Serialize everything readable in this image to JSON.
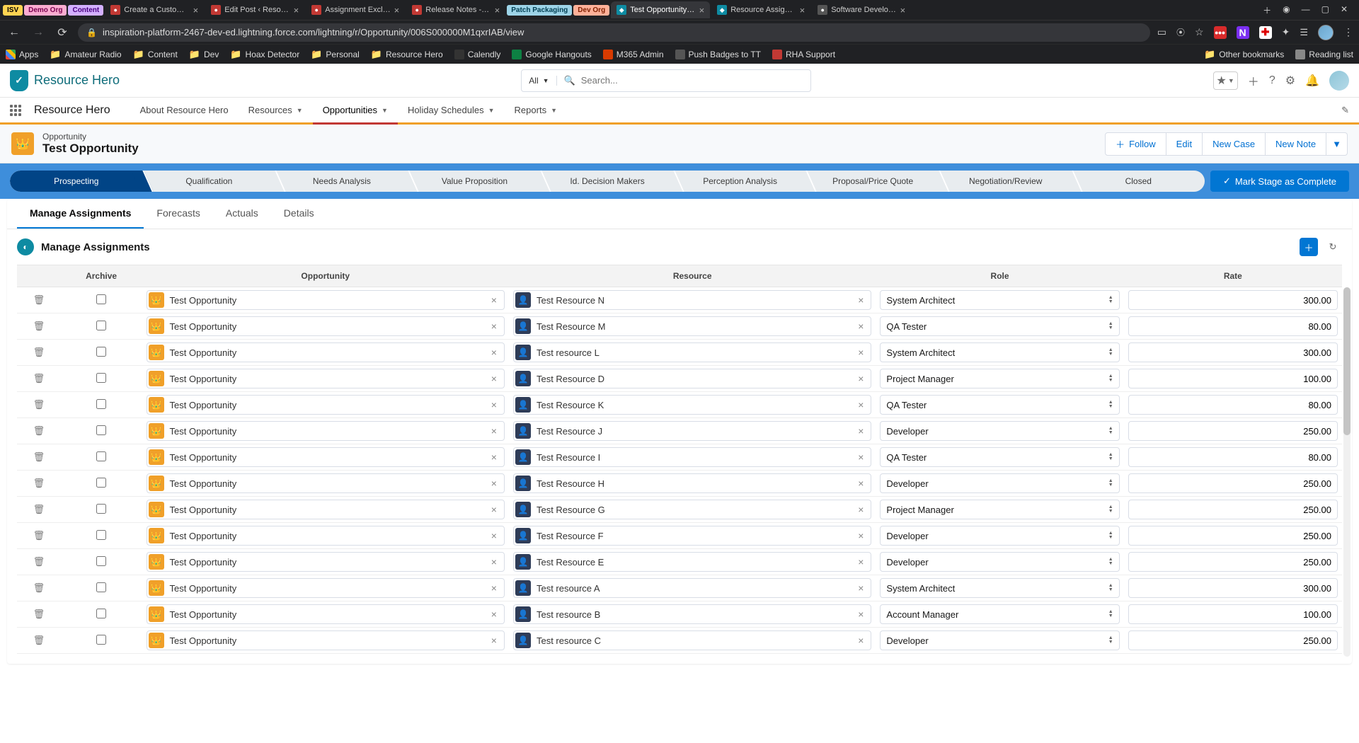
{
  "browser": {
    "tabs": [
      {
        "label": "ISV",
        "mini": "mini-isv"
      },
      {
        "label": "Demo Org",
        "mini": "mini-demo"
      },
      {
        "label": "Content",
        "mini": "mini-content"
      },
      {
        "label": "Create a Custom Ma",
        "fav_bg": "#c23934",
        "fav": "●"
      },
      {
        "label": "Edit Post ‹ Resource",
        "fav_bg": "#c23934",
        "fav": "●"
      },
      {
        "label": "Assignment Exclusio",
        "fav_bg": "#c23934",
        "fav": "●"
      },
      {
        "label": "Release Notes - Reso",
        "fav_bg": "#c23934",
        "fav": "●"
      },
      {
        "label": "Patch Packaging",
        "mini": "mini-patch"
      },
      {
        "label": "Dev Org",
        "mini": "mini-dev"
      },
      {
        "label": "Test Opportunity | Sa",
        "fav_bg": "#0e8ba2",
        "fav": "◆",
        "active": true
      },
      {
        "label": "Resource Assignmen",
        "fav_bg": "#0e8ba2",
        "fav": "◆"
      },
      {
        "label": "Software Developme",
        "fav_bg": "#555",
        "fav": "●"
      }
    ],
    "url": "inspiration-platform-2467-dev-ed.lightning.force.com/lightning/r/Opportunity/006S000000M1qxrIAB/view",
    "bookmarks_left": [
      {
        "label": "Apps",
        "icon_bg": "grid"
      },
      {
        "label": "Amateur Radio",
        "folder": true
      },
      {
        "label": "Content",
        "folder": true
      },
      {
        "label": "Dev",
        "folder": true
      },
      {
        "label": "Hoax Detector",
        "folder": true
      },
      {
        "label": "Personal",
        "folder": true
      },
      {
        "label": "Resource Hero",
        "folder": true
      },
      {
        "label": "Calendly",
        "icon_bg": "#333"
      },
      {
        "label": "Google Hangouts",
        "icon_bg": "#0d8043"
      },
      {
        "label": "M365 Admin",
        "icon_bg": "#d83b01"
      },
      {
        "label": "Push Badges to TT",
        "icon_bg": "#555"
      },
      {
        "label": "RHA Support",
        "icon_bg": "#c23934"
      }
    ],
    "bookmarks_right": [
      {
        "label": "Other bookmarks",
        "folder": true
      },
      {
        "label": "Reading list",
        "icon_bg": "#888"
      }
    ]
  },
  "header": {
    "app_logo_text": "Resource Hero",
    "search_scope": "All",
    "search_placeholder": "Search..."
  },
  "nav": {
    "app_name": "Resource Hero",
    "items": [
      {
        "label": "About Resource Hero"
      },
      {
        "label": "Resources",
        "caret": true
      },
      {
        "label": "Opportunities",
        "caret": true,
        "active": true
      },
      {
        "label": "Holiday Schedules",
        "caret": true
      },
      {
        "label": "Reports",
        "caret": true
      }
    ]
  },
  "record": {
    "type": "Opportunity",
    "name": "Test Opportunity",
    "actions": {
      "follow": "Follow",
      "edit": "Edit",
      "new_case": "New Case",
      "new_note": "New Note"
    }
  },
  "path": {
    "stages": [
      "Prospecting",
      "Qualification",
      "Needs Analysis",
      "Value Proposition",
      "Id. Decision Makers",
      "Perception Analysis",
      "Proposal/Price Quote",
      "Negotiation/Review",
      "Closed"
    ],
    "mark_complete": "Mark Stage as Complete"
  },
  "tabs": {
    "items": [
      {
        "label": "Manage Assignments",
        "active": true
      },
      {
        "label": "Forecasts"
      },
      {
        "label": "Actuals"
      },
      {
        "label": "Details"
      }
    ]
  },
  "section": {
    "title": "Manage Assignments"
  },
  "table": {
    "headers": {
      "archive": "Archive",
      "opportunity": "Opportunity",
      "resource": "Resource",
      "role": "Role",
      "rate": "Rate"
    },
    "rows": [
      {
        "opp": "Test Opportunity",
        "res": "Test Resource N",
        "role": "System Architect",
        "rate": "300.00"
      },
      {
        "opp": "Test Opportunity",
        "res": "Test Resource M",
        "role": "QA Tester",
        "rate": "80.00"
      },
      {
        "opp": "Test Opportunity",
        "res": "Test resource L",
        "role": "System Architect",
        "rate": "300.00"
      },
      {
        "opp": "Test Opportunity",
        "res": "Test Resource D",
        "role": "Project Manager",
        "rate": "100.00"
      },
      {
        "opp": "Test Opportunity",
        "res": "Test Resource K",
        "role": "QA Tester",
        "rate": "80.00"
      },
      {
        "opp": "Test Opportunity",
        "res": "Test Resource J",
        "role": "Developer",
        "rate": "250.00"
      },
      {
        "opp": "Test Opportunity",
        "res": "Test Resource I",
        "role": "QA Tester",
        "rate": "80.00"
      },
      {
        "opp": "Test Opportunity",
        "res": "Test Resource H",
        "role": "Developer",
        "rate": "250.00"
      },
      {
        "opp": "Test Opportunity",
        "res": "Test Resource G",
        "role": "Project Manager",
        "rate": "250.00"
      },
      {
        "opp": "Test Opportunity",
        "res": "Test Resource F",
        "role": "Developer",
        "rate": "250.00"
      },
      {
        "opp": "Test Opportunity",
        "res": "Test Resource E",
        "role": "Developer",
        "rate": "250.00"
      },
      {
        "opp": "Test Opportunity",
        "res": "Test resource A",
        "role": "System Architect",
        "rate": "300.00"
      },
      {
        "opp": "Test Opportunity",
        "res": "Test resource B",
        "role": "Account Manager",
        "rate": "100.00"
      },
      {
        "opp": "Test Opportunity",
        "res": "Test resource C",
        "role": "Developer",
        "rate": "250.00"
      }
    ]
  }
}
